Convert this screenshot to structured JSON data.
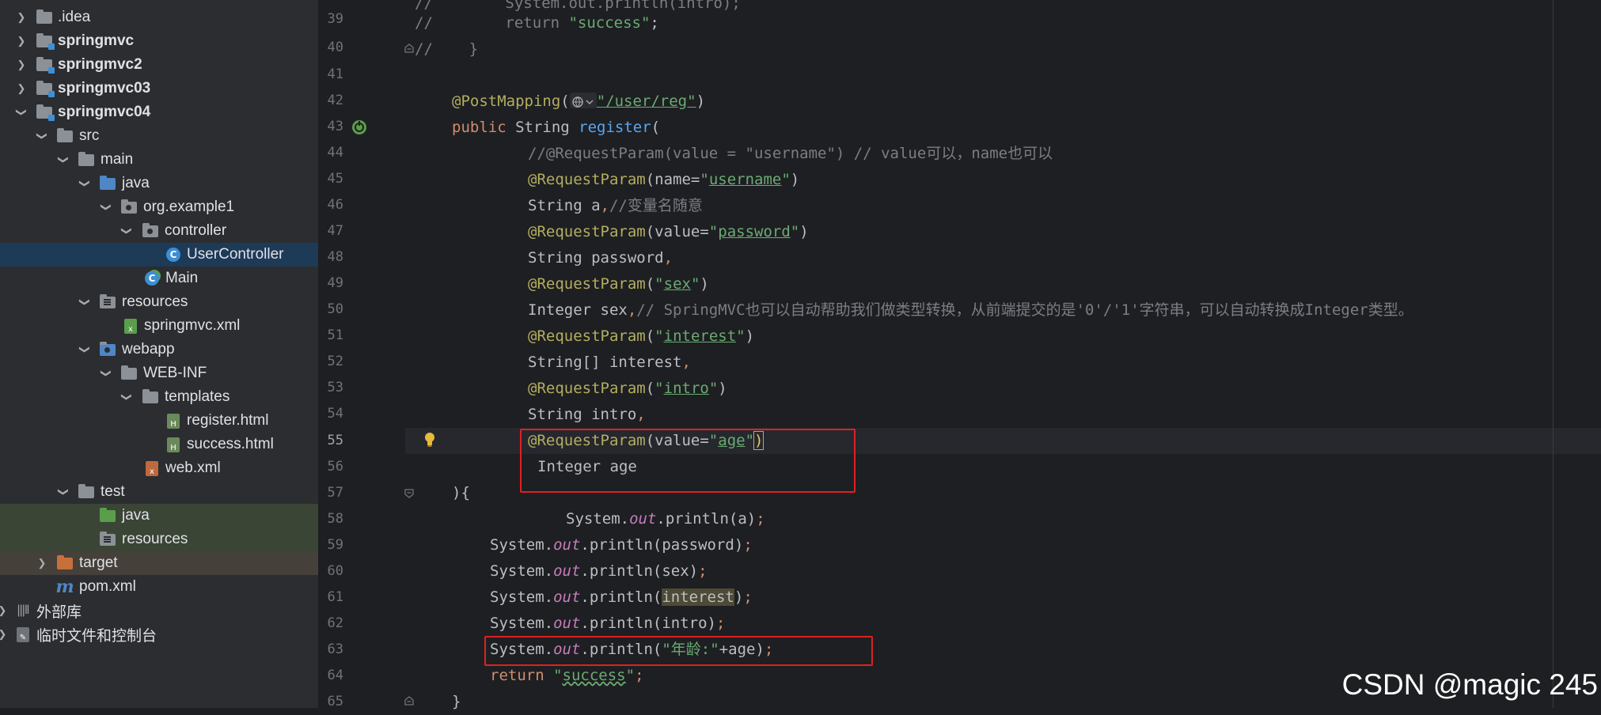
{
  "project_tree": {
    "items": [
      {
        "label": ".idea",
        "kind": "folder"
      },
      {
        "label": "springmvc",
        "kind": "module"
      },
      {
        "label": "springmvc2",
        "kind": "module"
      },
      {
        "label": "springmvc03",
        "kind": "module"
      },
      {
        "label": "springmvc04",
        "kind": "module"
      },
      {
        "label": "src",
        "kind": "folder"
      },
      {
        "label": "main",
        "kind": "folder"
      },
      {
        "label": "java",
        "kind": "source-folder"
      },
      {
        "label": "org.example1",
        "kind": "package"
      },
      {
        "label": "controller",
        "kind": "package"
      },
      {
        "label": "UserController",
        "kind": "class",
        "selected": true
      },
      {
        "label": "Main",
        "kind": "class"
      },
      {
        "label": "resources",
        "kind": "resources-folder"
      },
      {
        "label": "springmvc.xml",
        "kind": "xml-file"
      },
      {
        "label": "webapp",
        "kind": "web-folder"
      },
      {
        "label": "WEB-INF",
        "kind": "folder"
      },
      {
        "label": "templates",
        "kind": "folder"
      },
      {
        "label": "register.html",
        "kind": "html-file"
      },
      {
        "label": "success.html",
        "kind": "html-file"
      },
      {
        "label": "web.xml",
        "kind": "xml-file"
      },
      {
        "label": "test",
        "kind": "folder"
      },
      {
        "label": "java",
        "kind": "test-source-folder"
      },
      {
        "label": "resources",
        "kind": "test-resources-folder"
      },
      {
        "label": "target",
        "kind": "excluded-folder"
      },
      {
        "label": "pom.xml",
        "kind": "maven-file"
      },
      {
        "label": "外部库",
        "kind": "libraries"
      },
      {
        "label": "临时文件和控制台",
        "kind": "scratches"
      }
    ]
  },
  "editor": {
    "file": "UserController",
    "current_line": 55,
    "line_numbers": [
      "39",
      "40",
      "41",
      "42",
      "43",
      "44",
      "45",
      "46",
      "47",
      "48",
      "49",
      "50",
      "51",
      "52",
      "53",
      "54",
      "55",
      "56",
      "57",
      "58",
      "59",
      "60",
      "61",
      "62",
      "63",
      "64",
      "65"
    ],
    "lines": {
      "l39": {
        "a": "//        return ",
        "b": "\"success\"",
        "c": ";"
      },
      "l40": {
        "a": "//    }"
      },
      "l42": {
        "a": "@PostMapping",
        "b": "(",
        "c": "\"/user/reg\"",
        "d": ")"
      },
      "l43": {
        "a": "public ",
        "b": "String ",
        "c": "register",
        "d": "("
      },
      "l44": {
        "a": "//@RequestParam(value = \"username\") // value可以，name也可以"
      },
      "l45": {
        "a": "@RequestParam",
        "b": "(name=",
        "c": "\"",
        "d": "username",
        "e": "\"",
        "f": ")"
      },
      "l46": {
        "a": "String a",
        "b": ",",
        "c": "//变量名随意"
      },
      "l47": {
        "a": "@RequestParam",
        "b": "(value=",
        "c": "\"",
        "d": "password",
        "e": "\"",
        "f": ")"
      },
      "l48": {
        "a": "String password",
        "b": ","
      },
      "l49": {
        "a": "@RequestParam",
        "b": "(",
        "c": "\"",
        "d": "sex",
        "e": "\"",
        "f": ")"
      },
      "l50": {
        "a": "Integer sex",
        "b": ",",
        "c": "// SpringMVC也可以自动帮助我们做类型转换，从前端提交的是'0'/'1'字符串，可以自动转换成Integer类型。"
      },
      "l51": {
        "a": "@RequestParam",
        "b": "(",
        "c": "\"",
        "d": "interest",
        "e": "\"",
        "f": ")"
      },
      "l52": {
        "a": "String[] interest",
        "b": ","
      },
      "l53": {
        "a": "@RequestParam",
        "b": "(",
        "c": "\"",
        "d": "intro",
        "e": "\"",
        "f": ")"
      },
      "l54": {
        "a": "String intro",
        "b": ","
      },
      "l55": {
        "a": "@RequestParam",
        "b": "(value=",
        "c": "\"",
        "d": "age",
        "e": "\"",
        "f": ")"
      },
      "l56": {
        "a": "Integer age"
      },
      "l57": {
        "a": "){"
      },
      "l58": {
        "a": "System.",
        "b": "out",
        "c": ".println(a)",
        "d": ";"
      },
      "l59": {
        "a": "System.",
        "b": "out",
        "c": ".println(password)",
        "d": ";"
      },
      "l60": {
        "a": "System.",
        "b": "out",
        "c": ".println(sex)",
        "d": ";"
      },
      "l61": {
        "a": "System.",
        "b": "out",
        "c": ".println(",
        "e": "interest",
        "f": ")",
        "d": ";"
      },
      "l62": {
        "a": "System.",
        "b": "out",
        "c": ".println(intro)",
        "d": ";"
      },
      "l63": {
        "a": "System.",
        "b": "out",
        "c": ".println(",
        "e": "\"年龄:\"",
        "f": "+age)",
        "d": ";"
      },
      "l64": {
        "a": "return ",
        "b": "\"",
        "c": "success",
        "d": "\"",
        "e": ";"
      },
      "l65": {
        "a": "}"
      }
    }
  },
  "watermark": "CSDN @magic 245",
  "colors": {
    "annotation": "#b3ae60",
    "keyword": "#cf8e6d",
    "string": "#6aab73",
    "highlight_box": "#e02020"
  }
}
